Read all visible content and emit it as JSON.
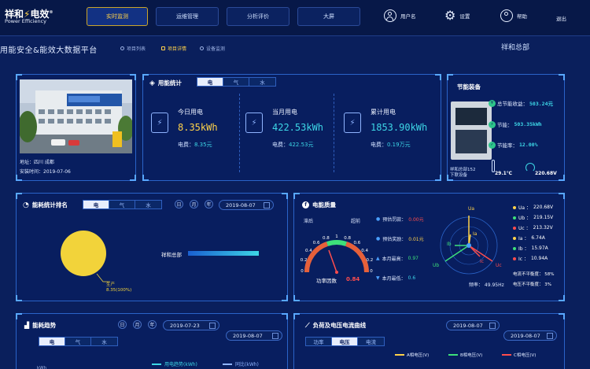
{
  "brand": {
    "name": "祥和",
    "name2": "电效",
    "registered": "®",
    "sub": "Power Efficiency"
  },
  "nav": [
    {
      "label": "实时监测",
      "active": true
    },
    {
      "label": "运维管理",
      "active": false
    },
    {
      "label": "分析评价",
      "active": false
    },
    {
      "label": "大屏",
      "active": false
    }
  ],
  "user": {
    "username": "用户名",
    "settings": "设置",
    "help": "帮助",
    "logout": "退出"
  },
  "page": {
    "title": "用能安全&能效大数据平台",
    "crumbs": [
      {
        "label": "项目列表",
        "active": false
      },
      {
        "label": "项目详情",
        "active": true
      },
      {
        "label": "设备监测",
        "active": false
      }
    ],
    "hq": "祥和总部"
  },
  "site": {
    "address": "地址：四川 成都",
    "install_date": "安装时间：2019-07-06"
  },
  "energy_stats": {
    "title": "用能统计",
    "tabs": [
      "电",
      "气",
      "水"
    ],
    "active_tab": 0,
    "cards": [
      {
        "label": "今日用电",
        "value": "8.35kWh",
        "fee_label": "电费：",
        "fee": "8.35元",
        "value_color": "#ffd24a"
      },
      {
        "label": "当月用电",
        "value": "422.53kWh",
        "fee_label": "电费：",
        "fee": "422.53元",
        "value_color": "#3dd6e6"
      },
      {
        "label": "累计用电",
        "value": "1853.90kWh",
        "fee_label": "电费：",
        "fee": "0.19万元",
        "value_color": "#3dd6e6"
      }
    ]
  },
  "saving": {
    "title": "节能装备",
    "items": [
      {
        "label": "总节能收益：",
        "value": "503.24元",
        "color": "#3dd6e6"
      },
      {
        "label": "节能：",
        "value": "503.35kWh",
        "color": "#3dd6e6"
      },
      {
        "label": "节能率：",
        "value": "12.00%",
        "color": "#3dd6e6"
      }
    ],
    "device_name": "祥和总部152",
    "device_sub": "下联设备",
    "temperature": "29.1℃",
    "voltage": "220.68V"
  },
  "ranking": {
    "title": "能耗统计排名",
    "tabs": [
      "电",
      "气",
      "水"
    ],
    "active_tab": 0,
    "period_buttons": [
      "日",
      "月",
      "年"
    ],
    "date": "2019-08-07",
    "bar_label": "祥和总部",
    "bar_fraction": 1.0,
    "pie_label": "生产",
    "pie_value": "8.35(100%)"
  },
  "power_quality": {
    "title": "电能质量",
    "lag": "滞后",
    "lead": "超前",
    "gauge_ticks": [
      "0",
      "0.2",
      "0.4",
      "0.6",
      "0.8",
      "1",
      "0.8",
      "0.6",
      "0.4",
      "0.2",
      "0"
    ],
    "pf_label": "功率因数",
    "pf_value": "0.84",
    "rows": [
      {
        "label": "预估罚款：",
        "value": "0.00元",
        "color": "#ff4d4d"
      },
      {
        "label": "预估奖励：",
        "value": "0.01元",
        "color": "#ffd24a"
      },
      {
        "label": "本月最高：",
        "value": "0.97",
        "color": "#3de07a"
      },
      {
        "label": "本月最低：",
        "value": "0.6",
        "color": "#3dd6e6"
      }
    ],
    "phasor_labels": [
      "Ua",
      "Ub",
      "Uc",
      "Ia",
      "Ib",
      "Ic"
    ],
    "readings": [
      {
        "label": "Ua ：",
        "value": "220.68V",
        "color": "#ffd24a"
      },
      {
        "label": "Ub ：",
        "value": "219.15V",
        "color": "#3de07a"
      },
      {
        "label": "Uc ：",
        "value": "213.32V",
        "color": "#ff4d4d"
      },
      {
        "label": "Ia ：",
        "value": "6.74A",
        "color": "#ffd24a"
      },
      {
        "label": "Ib ：",
        "value": "15.97A",
        "color": "#3de07a"
      },
      {
        "label": "Ic ：",
        "value": "10.94A",
        "color": "#ff4d4d"
      }
    ],
    "current_unbalance": "电流不平衡度： 58%",
    "voltage_unbalance": "电压不平衡度： 3%",
    "frequency": "频率： 49.95Hz"
  },
  "trend": {
    "title": "能耗趋势",
    "period_buttons": [
      "日",
      "月",
      "年"
    ],
    "date_from": "2019-07-23",
    "date_to": "2019-08-07",
    "tabs": [
      "电",
      "气",
      "水"
    ],
    "active_tab": 0,
    "legend": [
      "用电趋势(kWh)",
      "同比(kWh)"
    ],
    "y_unit": "kWh"
  },
  "load": {
    "title": "负荷及电压电流曲线",
    "date_from": "2019-08-07",
    "date_to": "2019-08-07",
    "tabs": [
      "功率",
      "电压",
      "电流"
    ],
    "active_tab": 1,
    "legend": [
      "A相电压(V)",
      "B相电压(V)",
      "C相电压(V)"
    ],
    "legend_colors": [
      "#ffd24a",
      "#3de07a",
      "#ff4d4d"
    ]
  }
}
